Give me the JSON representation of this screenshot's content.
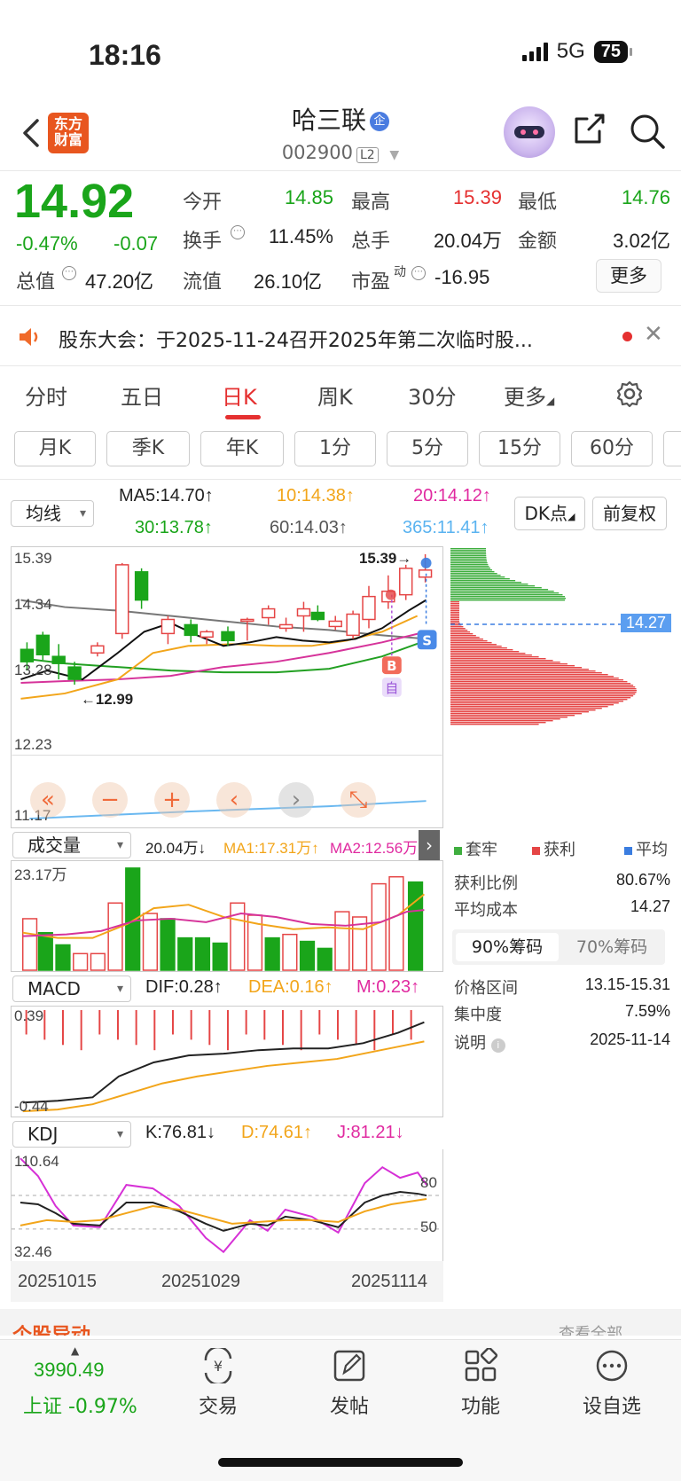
{
  "status_bar": {
    "time": "18:16",
    "network": "5G",
    "battery": "75"
  },
  "header": {
    "logo_text": "东方\n财富",
    "stock_name": "哈三联",
    "badge": "企",
    "code": "002900",
    "level": "L2"
  },
  "quote": {
    "price": "14.92",
    "change_pct": "-0.47%",
    "change": "-0.07",
    "rows": [
      [
        {
          "label": "今开",
          "value": "14.85",
          "color": "green"
        },
        {
          "label": "最高",
          "value": "15.39",
          "color": "red"
        },
        {
          "label": "最低",
          "value": "14.76",
          "color": "green"
        }
      ],
      [
        {
          "label": "换手",
          "value": "11.45%",
          "color": "black"
        },
        {
          "label": "总手",
          "value": "20.04万",
          "color": "black"
        },
        {
          "label": "金额",
          "value": "3.02亿",
          "color": "black"
        }
      ]
    ],
    "row3": {
      "total_mv_label": "总值",
      "total_mv": "47.20亿",
      "float_mv_label": "流值",
      "float_mv": "26.10亿",
      "pe_label": "市盈",
      "pe_sup": "动",
      "pe": "-16.95"
    },
    "more_label": "更多"
  },
  "notice": {
    "text": "股东大会：于2025-11-24召开2025年第二次临时股..."
  },
  "period_tabs": [
    "分时",
    "五日",
    "日K",
    "周K",
    "30分",
    "更多"
  ],
  "active_period": "日K",
  "sub_tabs": [
    "月K",
    "季K",
    "年K",
    "1分",
    "5分",
    "15分",
    "60分"
  ],
  "ma_bar": {
    "select": "均线",
    "ma5": "MA5:14.70↑",
    "ma10": "10:14.38↑",
    "ma20": "20:14.12↑",
    "ma30": "30:13.78↑",
    "ma60": "60:14.03↑",
    "ma365": "365:11.41↑",
    "dk_label": "DK点",
    "adj_label": "前复权"
  },
  "kline": {
    "y_labels": [
      "15.39",
      "14.34",
      "13.28",
      "12.23",
      "11.17"
    ],
    "high_marker": "15.39→",
    "low_marker": "←12.99",
    "buy_badge": "B",
    "self_badge": "自",
    "sell_badge": "S"
  },
  "chip_panel": {
    "legend": [
      {
        "label": "套牢",
        "color": "#3fae3f"
      },
      {
        "label": "获利",
        "color": "#e54545"
      },
      {
        "label": "平均",
        "color": "#3b7de0"
      }
    ],
    "avg_tag": "14.27",
    "stats1": [
      {
        "label": "获利比例",
        "value": "80.67%"
      },
      {
        "label": "平均成本",
        "value": "14.27"
      }
    ],
    "chips": [
      "90%筹码",
      "70%筹码"
    ],
    "stats2": [
      {
        "label": "价格区间",
        "value": "13.15-15.31"
      },
      {
        "label": "集中度",
        "value": "7.59%"
      },
      {
        "label": "说明",
        "value": "2025-11-14"
      }
    ]
  },
  "volume": {
    "select": "成交量",
    "vol": "20.04万↓",
    "ma1": "MA1:17.31万↑",
    "ma2": "MA2:12.56万↑",
    "y_top": "23.17万"
  },
  "macd": {
    "select": "MACD",
    "dif": "DIF:0.28↑",
    "dea": "DEA:0.16↑",
    "m": "M:0.23↑",
    "y_top": "0.39",
    "y_bottom": "-0.44"
  },
  "kdj": {
    "select": "KDJ",
    "k": "K:76.81↓",
    "d": "D:74.61↑",
    "j": "J:81.21↓",
    "y_top": "110.64",
    "y_bottom": "32.46",
    "lvl80": "80",
    "lvl50": "50"
  },
  "dates": [
    "20251015",
    "20251029",
    "20251114"
  ],
  "bottom_strip": {
    "left": "个股异动",
    "right": "查看全部"
  },
  "bottom_nav": {
    "index_value": "3990.49",
    "index_label": "上证 -0.97%",
    "items": [
      "交易",
      "发帖",
      "功能",
      "设自选"
    ]
  },
  "colors": {
    "up": "#e53030",
    "down": "#1aa51a",
    "accent": "#e8561f"
  }
}
